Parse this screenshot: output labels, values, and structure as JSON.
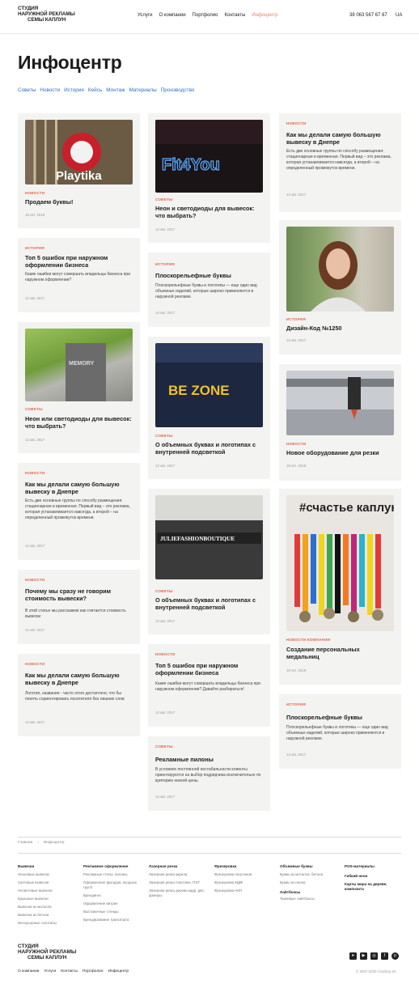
{
  "header": {
    "logo": [
      "СТУДИЯ",
      "НАРУЖНОЙ РЕКЛАМЫ",
      "СЕМЫ КАПЛУН"
    ],
    "nav": [
      "Услуги",
      "О компании",
      "Портфолио",
      "Контакты",
      "Инфоцентр"
    ],
    "active_nav": "Инфоцентр",
    "phone": "38 063 567 67 87",
    "lang": "UA"
  },
  "page": {
    "title": "Инфоцентр",
    "tabs": [
      "Советы",
      "Новости",
      "История",
      "Кейсь",
      "Монтаж",
      "Материалы",
      "Производство"
    ]
  },
  "cards": [
    {
      "tag": "НОВОСТИ",
      "title": "Продаем буквы!",
      "text": "",
      "date": "18 окт. 2018",
      "photo": "Playtika"
    },
    {
      "tag": "ИСТОРИЯ",
      "title": "Топ 5 ошибок при наружном оформлении бизнеса",
      "text": "Какие ошибки могут совершать владельцы бизнеса при наружном оформлении?",
      "date": "12 авг. 2017",
      "photo": ""
    },
    {
      "tag": "СОВЕТЫ",
      "title": "Неон или светодиоды для вывесок: что выбрать?",
      "text": "",
      "date": "12 авг. 2017",
      "photo": "MEMORY"
    },
    {
      "tag": "НОВОСТИ",
      "title": "Как мы делали самую большую вывеску в Днепре",
      "text": "Есть две основные группы по способу размещения: стационарная и временная. Первый вид – это реклама, которая устанавливается навсегда, а второй – на определенный промежуток времени.",
      "date": "12 авг. 2017",
      "photo": ""
    },
    {
      "tag": "НОВОСТИ",
      "title": "Почему мы сразу не говорим стоимость вывески?",
      "text": "В этой статье мы расскажем как считается стоимость вывески",
      "date": "12 авг. 2017",
      "photo": ""
    },
    {
      "tag": "НОВОСТИ",
      "title": "Как мы делали самую большую вывеску в Днепре",
      "text": "Логотип, название - часто этого достаточно, что бы понять сориентировать посетителя без лишних слов",
      "date": "12 авг. 2017",
      "photo": ""
    },
    {
      "tag": "СОВЕТЫ",
      "title": "Неон и светодиоды для вывесок: что выбрать?",
      "text": "",
      "date": "12 авг. 2017",
      "photo": "Fit4You"
    },
    {
      "tag": "ИСТОРИЯ",
      "title": "Плоскорельефные буквы",
      "text": "Плоскорельефные буквы и логотипы — еще один вид объемных изделий, которые широко применяются в наружной рекламе.",
      "date": "12 авг. 2017",
      "photo": ""
    },
    {
      "tag": "СОВЕТЫ",
      "title": "О объемных буквах и логотипах с внутренней подсветкой",
      "text": "",
      "date": "12 авг. 2017",
      "photo": "BE ZONE"
    },
    {
      "tag": "СОВЕТЫ",
      "title": "О объемных буквах и логотипах с внутренней подсветкой",
      "text": "",
      "date": "12 авг. 2017",
      "photo": "JULIEFASHIONBOUTIQUE"
    },
    {
      "tag": "НОВОСТИ",
      "title": "Топ 5 ошибок при наружном оформлении бизнеса",
      "text": "Какие ошибки могут совершать владельцы бизнеса при наружном оформлении? Давайте разбираться!",
      "date": "12 авг. 2017",
      "photo": ""
    },
    {
      "tag": "СОВЕТЫ",
      "title": "Рекламные пилоны",
      "text": "В условиях постоянной нестабильности клиенты ориентируются на выбор подрядчика исключительно по критерию низкой цены.",
      "date": "12 авг. 2017",
      "photo": ""
    },
    {
      "tag": "НОВОСТИ",
      "title": "Как мы делали самую большую вывеску в Днепре",
      "text": "Есть две основные группы по способу размещения: стационарная и временная. Первый вид – это реклама, которая устанавливается навсегда, а второй – на определенный промежуток времени.",
      "date": "12 авг. 2017",
      "photo": ""
    },
    {
      "tag": "ИСТОРИЯ",
      "title": "Дизайн-Код №1250",
      "text": "",
      "date": "12 авг. 2017",
      "photo": ""
    },
    {
      "tag": "НОВОСТИ",
      "title": "Новое оборудование для резки",
      "text": "",
      "date": "18 окт. 2018",
      "photo": ""
    },
    {
      "tag": "НОВОСТИ КОМПАНИИ",
      "title": "Создание персональных медальниц",
      "text": "",
      "date": "18 окт. 2018",
      "photo": "#счастье каплунов"
    },
    {
      "tag": "ИСТОРИЯ",
      "title": "Плоскорельефные буквы",
      "text": "Плоскорельефные буквы и логотипы — еще один вид объемных изделий, которые широко применяются в наружной рекламе.",
      "date": "12 авг. 2017",
      "photo": ""
    }
  ],
  "breadcrumb": [
    "Главная",
    "Инфоцентр"
  ],
  "footer": {
    "columns": [
      {
        "head": "Вывески",
        "items": [
          "Неоновые вывески",
          "Световые вывески",
          "Несветовые вывески",
          "Крышные вывески",
          "Вывески из металла",
          "Вывески из бетона",
          "Интерьерные логотипы"
        ]
      },
      {
        "head": "Рекламное оформление",
        "items": [
          "Рекламные стелы, пилоны",
          "Оформление фасадов, входных групп",
          "Брендинги",
          "Оформление витрин",
          "Выставочные стенды",
          "Брендирование транспорта"
        ]
      },
      {
        "head": "Лазерная резка",
        "items": [
          "Лазерная резка акрила",
          "Лазерная резка пластика, ПЭТ",
          "Лазерная резка дерева мдф, двп, фанеры"
        ]
      },
      {
        "head": "Фрезеровка",
        "items": [
          "Фрезеровка пластиков",
          "Фрезеровка МДФ",
          "Фрезеровка АКП"
        ]
      },
      {
        "head": "Объемные буквы",
        "items": [
          "Буквы из металла, бетона",
          "Буквы из неона"
        ],
        "extra": "Лайтбоксы",
        "extra_items": [
          "Тканевые лайтбоксы"
        ]
      },
      {
        "head": "POS-материалы",
        "items": [],
        "bold_items": [
          "Гибкий неон",
          "Карты мира на дереве, композита"
        ]
      }
    ],
    "logo": [
      "СТУДИЯ",
      "НАРУЖНОЙ РЕКЛАМЫ",
      "СЕМЫ КАПЛУН"
    ],
    "nav": [
      "О компании",
      "Услуги",
      "Контакты",
      "Портфолио",
      "Инфоцентр"
    ],
    "social": [
      "telegram-icon",
      "youtube-icon",
      "instagram-icon",
      "facebook-icon",
      "pinterest-icon"
    ],
    "copyright": "© 2007-2020 Crazboy art"
  }
}
